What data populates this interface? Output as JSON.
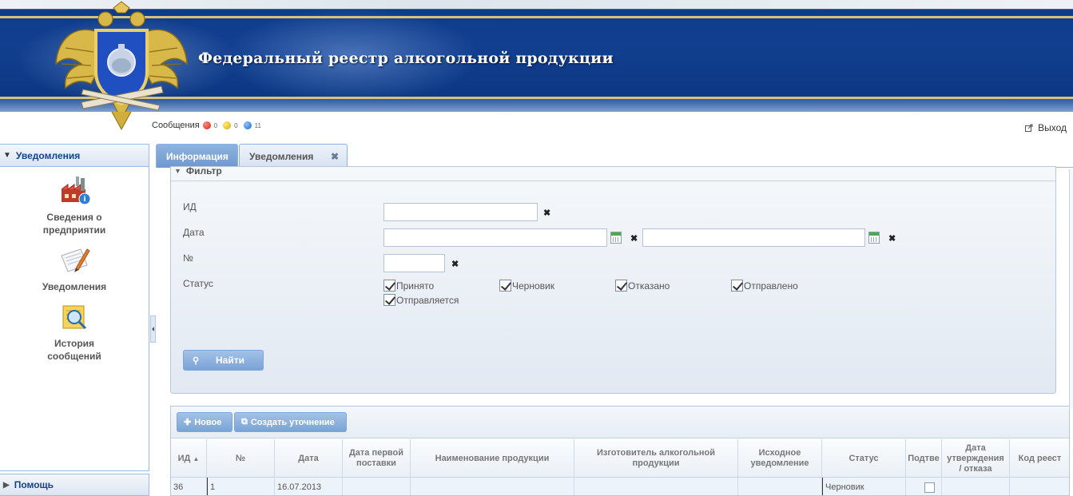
{
  "header": {
    "title": "Федеральный реестр алкогольной продукции"
  },
  "messages": {
    "label": "Сообщения",
    "red": "0",
    "yellow": "0",
    "blue": "11"
  },
  "logout": {
    "label": "Выход"
  },
  "sidebar": {
    "title": "Уведомления",
    "items": [
      {
        "label": "Сведения о\nпредприятии",
        "icon": "factory-icon"
      },
      {
        "label": "Уведомления",
        "icon": "document-pencil-icon"
      },
      {
        "label": "История\nсообщений",
        "icon": "magnifier-icon"
      }
    ],
    "help": "Помощь"
  },
  "tabs": [
    {
      "label": "Информация",
      "active": false
    },
    {
      "label": "Уведомления",
      "active": true
    }
  ],
  "filter": {
    "legend": "Фильтр",
    "labels": {
      "id": "ИД",
      "date": "Дата",
      "number": "№",
      "status": "Статус"
    },
    "values": {
      "id": "",
      "date_from": "",
      "date_to": "",
      "number": ""
    },
    "statuses": [
      {
        "label": "Принято",
        "checked": true
      },
      {
        "label": "Черновик",
        "checked": true
      },
      {
        "label": "Отказано",
        "checked": true
      },
      {
        "label": "Отправлено",
        "checked": true
      },
      {
        "label": "Отправляется",
        "checked": true
      }
    ],
    "find_button": "Найти"
  },
  "grid": {
    "toolbar": {
      "new": "Новое",
      "create_clarification": "Создать уточнение"
    },
    "columns": [
      "ИД",
      "№",
      "Дата",
      "Дата первой\nпоставки",
      "Наименование продукции",
      "Изготовитель алкогольной\nпродукции",
      "Исходное\nуведомление",
      "Статус",
      "Подтве",
      "Дата\nутверждения\n/ отказа",
      "Код реест"
    ],
    "rows": [
      [
        "36",
        "1",
        "16.07.2013",
        "",
        "",
        "",
        "",
        "Черновик",
        "",
        "",
        ""
      ]
    ]
  },
  "colors": {
    "banner_blue": "#0e3c8c",
    "accent_gold": "#d8c27a",
    "tab_active": "#7aa3d6",
    "link_text": "#15428b"
  }
}
